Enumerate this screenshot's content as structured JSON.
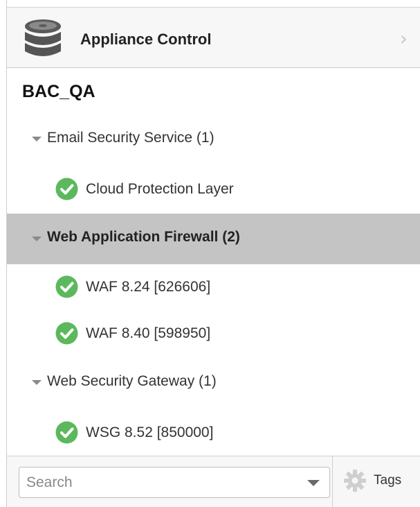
{
  "header": {
    "title": "Appliance Control",
    "icon": "database-icon",
    "chevron": "›"
  },
  "tree": {
    "tenant": "BAC_QA",
    "groups": [
      {
        "label": "Email Security Service (1)",
        "expanded": true,
        "selected": false,
        "items": [
          {
            "label": "Cloud Protection Layer",
            "status": "ok"
          }
        ]
      },
      {
        "label": "Web Application Firewall (2)",
        "expanded": true,
        "selected": true,
        "items": [
          {
            "label": "WAF 8.24 [626606]",
            "status": "ok"
          },
          {
            "label": "WAF 8.40 [598950]",
            "status": "ok"
          }
        ]
      },
      {
        "label": "Web Security Gateway (1)",
        "expanded": true,
        "selected": false,
        "items": [
          {
            "label": "WSG 8.52 [850000]",
            "status": "ok"
          }
        ]
      }
    ]
  },
  "footer": {
    "search_placeholder": "Search",
    "search_value": "",
    "tags_label": "Tags"
  },
  "colors": {
    "status_ok": "#5cb85c",
    "selected_row": "#c4c4c4",
    "header_bg": "#f7f7f7"
  }
}
